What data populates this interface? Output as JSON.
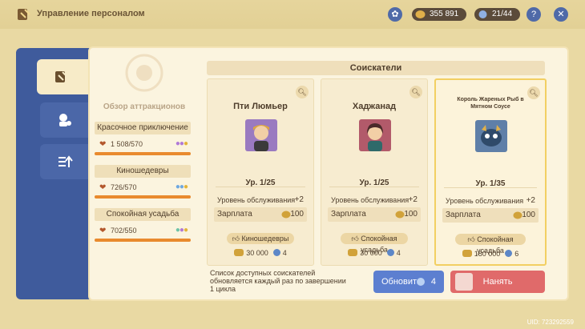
{
  "header": {
    "title": "Управление персоналом",
    "currency": "355 891",
    "capacity": "21/44",
    "help": "?",
    "close": "✕"
  },
  "overview": {
    "title": "Обзор аттракционов",
    "attractions": [
      {
        "name": "Красочное приключение",
        "score": "1 508/570",
        "level": 1.0
      },
      {
        "name": "Киношедевры",
        "score": "726/570",
        "level": 1.0
      },
      {
        "name": "Спокойная усадьба",
        "score": "702/550",
        "level": 1.0
      }
    ]
  },
  "candidates": {
    "title": "Соискатели",
    "cards": [
      {
        "name": "Пти Люмьер",
        "level": "Ур. 1/25",
        "service_label": "Уровень обслуживания",
        "service": "+2",
        "salary_label": "Зарплата",
        "salary": "100",
        "tag": "Киношедевры",
        "cost": "30 000",
        "time": "4"
      },
      {
        "name": "Хаджанад",
        "level": "Ур. 1/25",
        "service_label": "Уровень обслуживания",
        "service": "+2",
        "salary_label": "Зарплата",
        "salary": "100",
        "tag": "Спокойная усадьба",
        "cost": "30 000",
        "time": "4"
      },
      {
        "name": "Король Жареных Рыб в Мятном Соусе",
        "level": "Ур. 1/35",
        "service_label": "Уровень обслуживания",
        "service": "+2",
        "salary_label": "Зарплата",
        "salary": "100",
        "tag": "Спокойная усадьба",
        "cost": "180 000",
        "time": "6"
      }
    ]
  },
  "footer": {
    "note": "Список доступных соискателей обновляется каждый раз по завершении 1 цикла",
    "refresh_label": "Обновить",
    "refresh_count": "4",
    "hire_label": "Нанять",
    "uid": "UID: 723292559"
  },
  "colors": {
    "accent_blue": "#4f6aa8",
    "hire_red": "#e06a6a",
    "progress_orange": "#e98a2e"
  }
}
